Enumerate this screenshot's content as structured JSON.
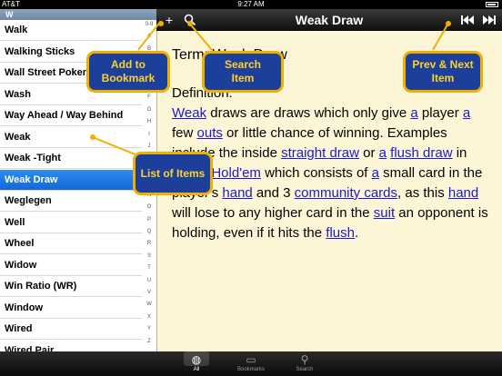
{
  "status_bar": {
    "carrier": "AT&T",
    "time": "9:27 AM",
    "battery": "battery-icon"
  },
  "list": {
    "header": "W",
    "selected_index": 7,
    "items": [
      "Walk",
      "Walking Sticks",
      "Wall Street Poker",
      "Wash",
      "Way Ahead / Way Behind",
      "Weak",
      "Weak -Tight",
      "Weak Draw",
      "Weglegen",
      "Well",
      "Wheel",
      "Widow",
      "Win Ratio (WR)",
      "Window",
      "Wired",
      "Wired Pair"
    ],
    "index_letters": [
      "0-9",
      "A",
      "B",
      "C",
      "D",
      "E",
      "F",
      "G",
      "H",
      "I",
      "J",
      "K",
      "L",
      "M",
      "N",
      "O",
      "P",
      "Q",
      "R",
      "S",
      "T",
      "U",
      "V",
      "W",
      "X",
      "Y",
      "Z"
    ]
  },
  "toolbar": {
    "title": "Weak Draw",
    "add_glyph": "+",
    "search_glyph": "⚲",
    "prev_glyph": "⏮",
    "next_glyph": "⏭"
  },
  "content": {
    "term_label": "Term: Weak Draw",
    "definition_label": "Definition:",
    "definition": [
      {
        "t": "Weak",
        "link": true
      },
      {
        "t": " draws are draws which only give ",
        "link": false
      },
      {
        "t": "a",
        "link": true
      },
      {
        "t": " player ",
        "link": false
      },
      {
        "t": "a",
        "link": true
      },
      {
        "t": " few ",
        "link": false
      },
      {
        "t": "outs",
        "link": true
      },
      {
        "t": " or little chance of winning. Examples include the inside ",
        "link": false
      },
      {
        "t": "straight draw",
        "link": true
      },
      {
        "t": " or ",
        "link": false
      },
      {
        "t": "a",
        "link": true
      },
      {
        "t": " ",
        "link": false
      },
      {
        "t": "flush draw",
        "link": true
      },
      {
        "t": " in ",
        "link": false
      },
      {
        "t": "Texas Hold'em",
        "link": true
      },
      {
        "t": " which consists of ",
        "link": false
      },
      {
        "t": "a",
        "link": true
      },
      {
        "t": " small card in the player's ",
        "link": false
      },
      {
        "t": "hand",
        "link": true
      },
      {
        "t": " and 3 ",
        "link": false
      },
      {
        "t": "community cards",
        "link": true
      },
      {
        "t": ", as this ",
        "link": false
      },
      {
        "t": "hand",
        "link": true
      },
      {
        "t": " will lose to any higher card in the ",
        "link": false
      },
      {
        "t": "suit",
        "link": true
      },
      {
        "t": " an opponent is holding, even if it hits the ",
        "link": false
      },
      {
        "t": "flush",
        "link": true
      },
      {
        "t": ".",
        "link": false
      }
    ]
  },
  "callouts": {
    "add_bookmark": "Add to Bookmark",
    "search_item": "Search Item",
    "prev_next": "Prev & Next Item",
    "list_items": "List of Items"
  },
  "tabbar": {
    "tabs": [
      {
        "label": "All",
        "icon": "globe-icon",
        "glyph": "◍"
      },
      {
        "label": "Bookmarks",
        "icon": "book-icon",
        "glyph": "▭"
      },
      {
        "label": "Search",
        "icon": "search-icon",
        "glyph": "⚲"
      }
    ]
  },
  "colors": {
    "selected_row": "#1467d8",
    "link": "#1a1acc",
    "content_bg": "#fdf6d6",
    "callout_bg": "#1b3f9a",
    "callout_border": "#f0b000",
    "callout_text": "#ffd22a"
  }
}
